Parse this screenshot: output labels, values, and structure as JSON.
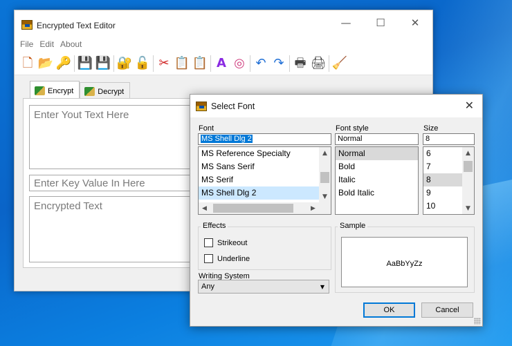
{
  "colors": {
    "desktop": "#0a6fd4",
    "selection": "#0078d7",
    "list_highlight": "#cce8ff"
  },
  "main_window": {
    "title": "Encrypted Text Editor",
    "controls": {
      "minimize": "—",
      "maximize": "☐",
      "close": "✕"
    },
    "menu": [
      "File",
      "Edit",
      "About"
    ],
    "toolbar_icons": [
      "new-icon",
      "open-icon",
      "open-key-icon",
      "save-icon",
      "save-as-icon",
      "encrypt-icon",
      "decrypt-icon",
      "cut-icon",
      "copy-icon",
      "paste-icon",
      "font-icon",
      "color-icon",
      "undo-icon",
      "redo-icon",
      "print-icon",
      "print-preview-icon",
      "clear-icon"
    ],
    "toolbar_glyphs": [
      "🗋",
      "📂",
      "🔑",
      "💾",
      "💾",
      "🔐",
      "🔓",
      "✂",
      "📋",
      "📋",
      "A",
      "◎",
      "↶",
      "↷",
      "🖶",
      "🖨",
      "🧹"
    ],
    "tabs": [
      {
        "label": "Encrypt"
      },
      {
        "label": "Decrypt"
      }
    ],
    "text_placeholder": "Enter Yout Text Here",
    "key_placeholder": "Enter Key Value In Here",
    "output_placeholder": "Encrypted Text"
  },
  "font_dialog": {
    "title": "Select Font",
    "close": "✕",
    "font_label": "Font",
    "font_value": "MS Shell Dlg 2",
    "fonts": [
      "MS Reference Specialty",
      "MS Sans Serif",
      "MS Serif",
      "MS Shell Dlg 2"
    ],
    "style_label": "Font style",
    "style_value": "Normal",
    "styles": [
      "Normal",
      "Bold",
      "Italic",
      "Bold Italic"
    ],
    "size_label": "Size",
    "size_value": "8",
    "sizes": [
      "6",
      "7",
      "8",
      "9",
      "10"
    ],
    "effects_label": "Effects",
    "strikeout_label": "Strikeout",
    "underline_label": "Underline",
    "sample_label": "Sample",
    "sample_text": "AaBbYyZz",
    "writing_system_label": "Writing System",
    "writing_system_value": "Any",
    "ok_label": "OK",
    "cancel_label": "Cancel"
  }
}
